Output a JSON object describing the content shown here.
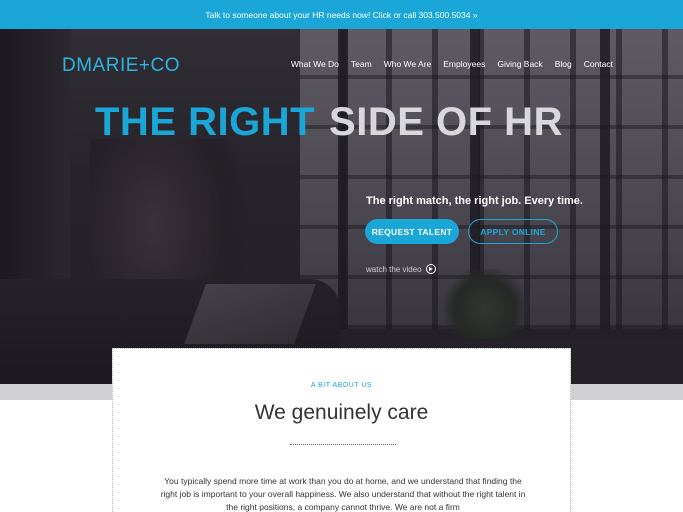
{
  "announcement": "Talk to someone about your HR needs now! Click or call 303.500.5034 »",
  "logo": {
    "text": "DMARIE",
    "plus": "+",
    "suffix": "CO"
  },
  "nav": [
    "What We Do",
    "Team",
    "Who We Are",
    "Employees",
    "Giving Back",
    "Blog",
    "Contact"
  ],
  "hero": {
    "headline_part1": "THE RIGHT",
    "headline_part2": "SIDE OF HR",
    "tagline": "The right match, the right job. Every time.",
    "request_button": "REQUEST TALENT",
    "apply_button": "APPLY ONLINE",
    "watch_label": "watch the video"
  },
  "about": {
    "eyebrow": "A BIT ABOUT US",
    "title": "We genuinely care",
    "paragraph": "You typically spend more time at work than you do at home, and we understand that finding the right job is important to your overall happiness. We also understand that without the right talent in the right positions, a company cannot thrive. We are not a firm"
  },
  "colors": {
    "accent": "#1aa6d6",
    "headline_white": "#d8d7dc",
    "band": "#d0d0d2"
  }
}
